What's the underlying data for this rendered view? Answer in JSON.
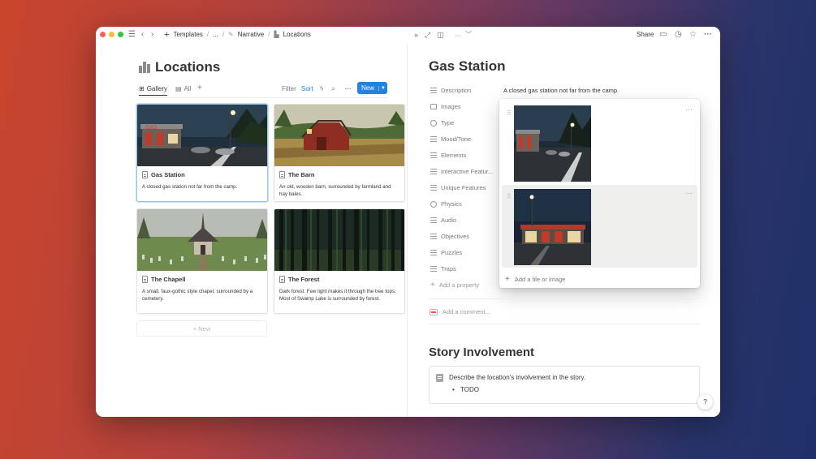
{
  "titlebar": {
    "breadcrumbs": [
      "Templates",
      "...",
      "Narrative",
      "Locations"
    ],
    "share_label": "Share"
  },
  "database": {
    "title": "Locations",
    "views": [
      {
        "label": "Gallery",
        "active": true
      },
      {
        "label": "All",
        "active": false
      }
    ],
    "filter_label": "Filter",
    "sort_label": "Sort",
    "new_label": "New",
    "new_row_label": "+ New",
    "cards": [
      {
        "title": "Gas Station",
        "desc": "A closed gas station not far from the camp.",
        "selected": true
      },
      {
        "title": "The Barn",
        "desc": "An old, wooden barn, surrounded by farmland and hay bales."
      },
      {
        "title": "The Chapell",
        "desc": "A small, faux-gothic style chapel, surrounded by a cemetery."
      },
      {
        "title": "The Forest",
        "desc": "Dark forest. Few light makes it through the tree tops. Most of Swamp Lake is surrounded by forest."
      }
    ]
  },
  "page": {
    "title": "Gas Station",
    "properties": [
      {
        "label": "Description",
        "icon": "text-lines-icon"
      },
      {
        "label": "Images",
        "icon": "image-icon"
      },
      {
        "label": "Type",
        "icon": "select-circle-icon"
      },
      {
        "label": "Mood/Tone",
        "icon": "text-lines-icon"
      },
      {
        "label": "Elements",
        "icon": "text-lines-icon"
      },
      {
        "label": "Interactive Featur...",
        "icon": "text-lines-icon"
      },
      {
        "label": "Unique Features",
        "icon": "text-lines-icon"
      },
      {
        "label": "Physics",
        "icon": "select-circle-icon"
      },
      {
        "label": "Audio",
        "icon": "text-lines-icon"
      },
      {
        "label": "Objectives",
        "icon": "text-lines-icon"
      },
      {
        "label": "Puzzles",
        "icon": "text-lines-icon"
      },
      {
        "label": "Traps",
        "icon": "text-lines-icon"
      }
    ],
    "description_value": "A closed gas station not far from the camp.",
    "add_property_label": "Add a property",
    "add_file_label": "Add a file or image",
    "add_comment_label": "Add a comment...",
    "section_heading": "Story Involvement",
    "callout_text": "Describe the location's involvement in the story.",
    "callout_bullet": "TODO",
    "help_label": "?"
  },
  "colors": {
    "accent": "#2383e2",
    "text": "#37352f",
    "muted": "#787774"
  }
}
